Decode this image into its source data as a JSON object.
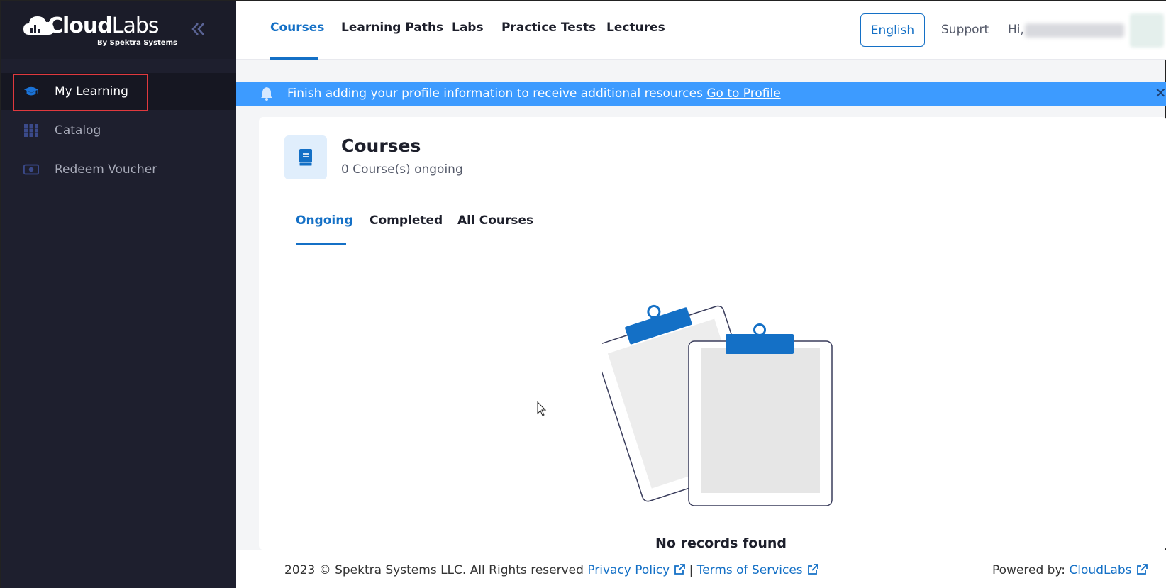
{
  "app": {
    "logo_main": "Cloud",
    "logo_secondary": "Labs",
    "logo_sub": "By Spektra Systems",
    "collapse_icon": "double-chevron-left-icon"
  },
  "sidebar": {
    "items": [
      {
        "label": "My Learning",
        "icon": "graduation-cap-icon",
        "active": true
      },
      {
        "label": "Catalog",
        "icon": "grid-icon",
        "active": false
      },
      {
        "label": "Redeem Voucher",
        "icon": "voucher-icon",
        "active": false
      }
    ]
  },
  "header": {
    "tabs": [
      {
        "label": "Courses",
        "active": true
      },
      {
        "label": "Learning Paths",
        "active": false
      },
      {
        "label": "Labs",
        "active": false
      },
      {
        "label": "Practice Tests",
        "active": false
      },
      {
        "label": "Lectures",
        "active": false
      }
    ],
    "language": "English",
    "support": "Support",
    "greeting": "Hi,"
  },
  "banner": {
    "text": "Finish adding your profile information to receive additional resources",
    "link": "Go to Profile",
    "icon": "bell-icon",
    "close_icon": "close-icon"
  },
  "courses": {
    "title": "Courses",
    "subtitle": "0 Course(s) ongoing",
    "tabs": [
      {
        "label": "Ongoing",
        "active": true
      },
      {
        "label": "Completed",
        "active": false
      },
      {
        "label": "All Courses",
        "active": false
      }
    ],
    "empty_message": "No records found"
  },
  "footer": {
    "copyright": "2023 © Spektra Systems LLC. All Rights reserved",
    "privacy": "Privacy Policy",
    "separator": "|",
    "terms": "Terms of Services",
    "powered_label": "Powered by:",
    "powered_link": "CloudLabs"
  },
  "colors": {
    "accent": "#1470c6",
    "sidebar_bg": "#1e1f2e",
    "banner_bg": "#3d9bff",
    "highlight": "#e0393e"
  }
}
